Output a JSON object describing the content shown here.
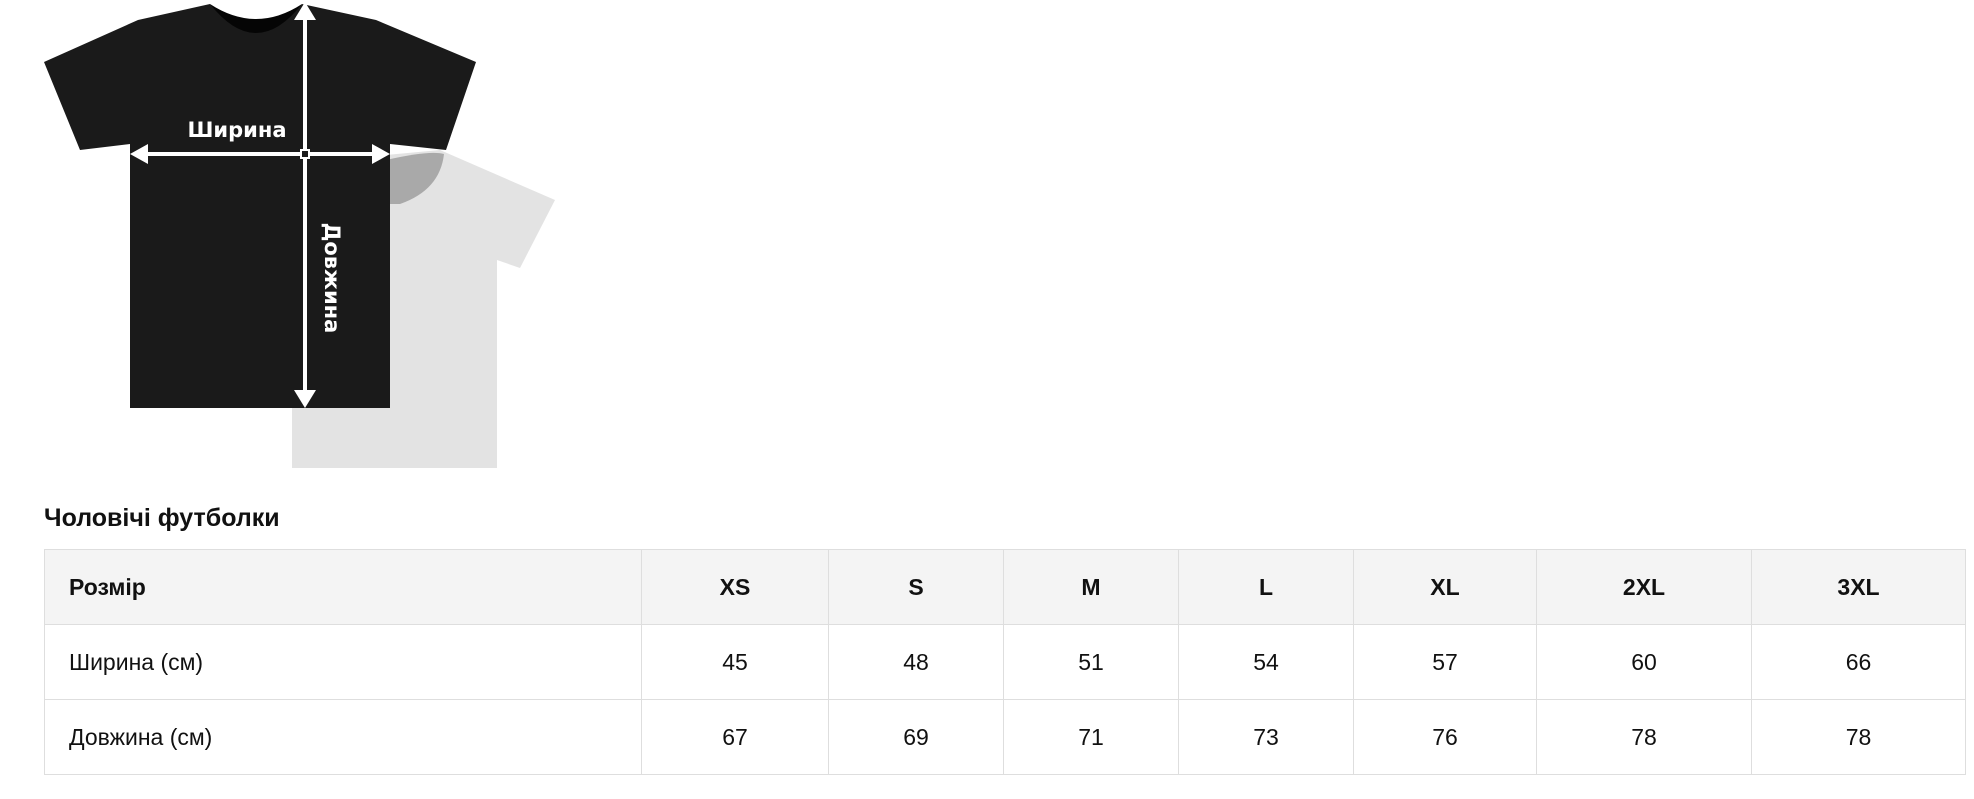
{
  "illustration": {
    "width_label": "Ширина",
    "length_label": "Довжина"
  },
  "section_title": "Чоловічі футболки",
  "table": {
    "header_label": "Розмір",
    "sizes": [
      "XS",
      "S",
      "M",
      "L",
      "XL",
      "2XL",
      "3XL"
    ],
    "rows": [
      {
        "label": "Ширина (см)",
        "values": [
          "45",
          "48",
          "51",
          "54",
          "57",
          "60",
          "66"
        ]
      },
      {
        "label": "Довжина (см)",
        "values": [
          "67",
          "69",
          "71",
          "73",
          "76",
          "78",
          "78"
        ]
      }
    ]
  },
  "colors": {
    "shirt_front": "#1a1a1a",
    "shirt_back": "#e3e3e3",
    "header_bg": "#f4f4f4",
    "border": "#dedede"
  }
}
